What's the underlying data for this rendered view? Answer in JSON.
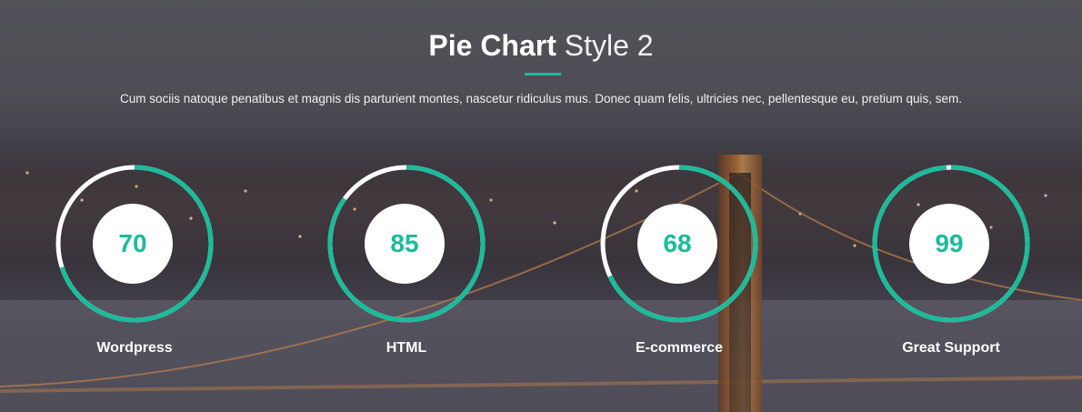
{
  "header": {
    "title_bold": "Pie Chart",
    "title_light": "Style 2",
    "subtitle": "Cum sociis natoque penatibus et magnis dis parturient montes, nascetur ridiculus mus. Donec quam felis, ultricies nec, pellentesque eu, pretium quis, sem."
  },
  "colors": {
    "accent": "#1bbc9b",
    "track": "#ffffff",
    "text": "#ffffff"
  },
  "pies": [
    {
      "value": 70,
      "label": "Wordpress"
    },
    {
      "value": 85,
      "label": "HTML"
    },
    {
      "value": 68,
      "label": "E-commerce"
    },
    {
      "value": 99,
      "label": "Great Support"
    }
  ]
}
